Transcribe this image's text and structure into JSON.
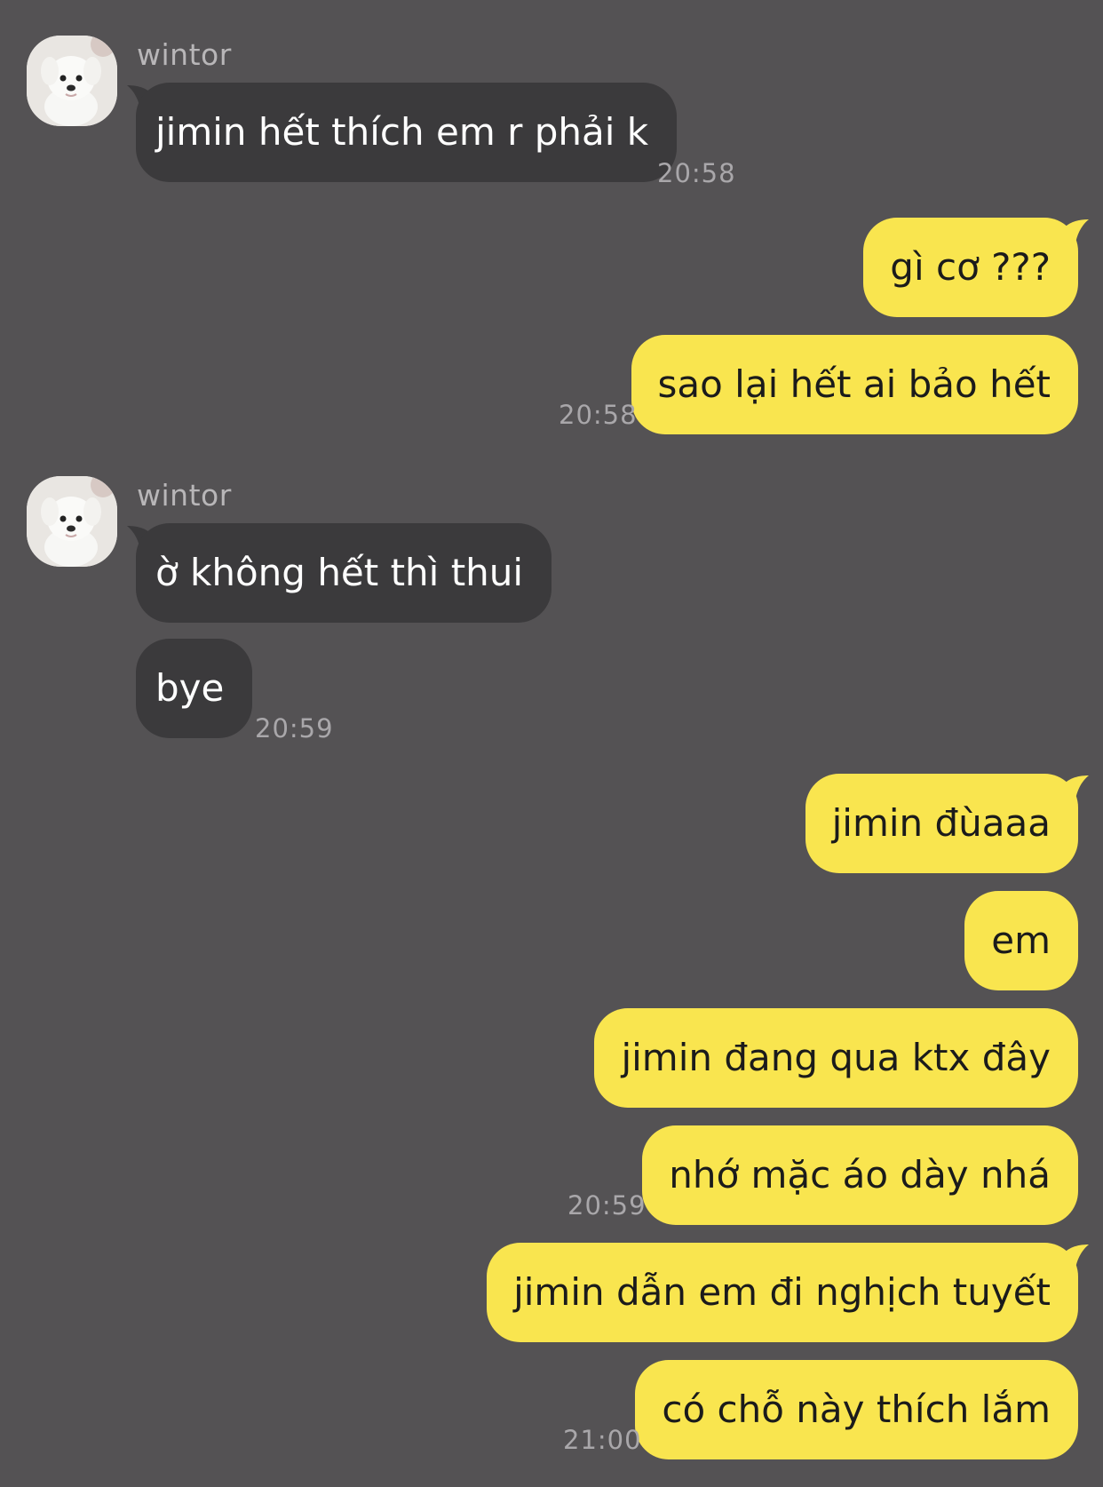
{
  "colors": {
    "background": "#545254",
    "incoming_bubble": "#3b3a3c",
    "outgoing_bubble": "#f9e54f",
    "timestamp": "#a9a7aa",
    "sender_name": "#b8b6b8"
  },
  "messages": {
    "m1": {
      "sender": "wintor",
      "text": "jimin hết thích em r phải k",
      "time": "20:58"
    },
    "m2": {
      "text": "gì cơ ???"
    },
    "m3": {
      "text": "sao lại hết ai bảo hết",
      "time": "20:58"
    },
    "m4": {
      "sender": "wintor",
      "text": "ờ không hết thì thui"
    },
    "m5": {
      "text": "bye",
      "time": "20:59"
    },
    "m6": {
      "text": "jimin đùaaa"
    },
    "m7": {
      "text": "em"
    },
    "m8": {
      "text": "jimin đang qua ktx đây"
    },
    "m9": {
      "text": "nhớ mặc áo dày nhá",
      "time": "20:59"
    },
    "m10": {
      "text": "jimin dẫn em đi nghịch tuyết"
    },
    "m11": {
      "text": "có chỗ này thích lắm",
      "time": "21:00"
    }
  },
  "icons": {
    "avatar": "white-puppy-avatar"
  }
}
